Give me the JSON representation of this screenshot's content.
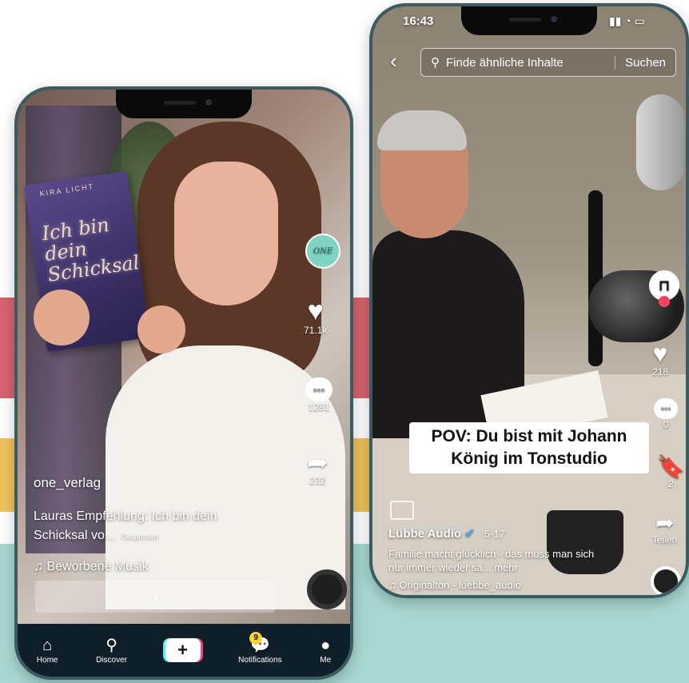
{
  "colors": {
    "red_band": "#d9646d",
    "yellow_band": "#efc35a",
    "teal_band": "#a9d8d2",
    "phone_border": "#3b5b63",
    "nav_bg": "#0f1f2a",
    "badge": "#f6d23b"
  },
  "left_phone": {
    "book": {
      "author": "KIRA LICHT",
      "title": "Ich bin dein Schicksal"
    },
    "profile_badge": "ONE",
    "actions": {
      "likes": "71.1k",
      "comments": "1281",
      "shares": "232"
    },
    "username": "one_verlag",
    "caption": "Lauras Empfehlung: Ich bin dein Schicksal vo...",
    "sponsored_label": "Gesponsert",
    "music": "♫ Beworbene Musik",
    "cta_arrow": "›",
    "nav": {
      "home": {
        "icon": "home-icon",
        "label": "Home"
      },
      "discover": {
        "icon": "search-icon",
        "label": "Discover"
      },
      "create": {
        "icon": "plus-icon",
        "label": "+"
      },
      "notifications": {
        "icon": "message-icon",
        "label": "Notifications",
        "badge": "9"
      },
      "me": {
        "icon": "person-icon",
        "label": "Me"
      }
    }
  },
  "right_phone": {
    "status_time": "16:43",
    "search": {
      "placeholder": "Finde ähnliche Inhalte",
      "button": "Suchen"
    },
    "caption_overlay": "POV: Du bist mit Johann König im Tonstudio",
    "username": "Lübbe Audio",
    "date": "· 5-17",
    "description": "Familie macht glücklich - das muss man sich nur immer wieder sa... mehr",
    "music": "♫ Originalton - luebbe_audio",
    "actions": {
      "likes": "218",
      "comments": "0",
      "saves": "2",
      "share_label": "Teilen"
    }
  }
}
